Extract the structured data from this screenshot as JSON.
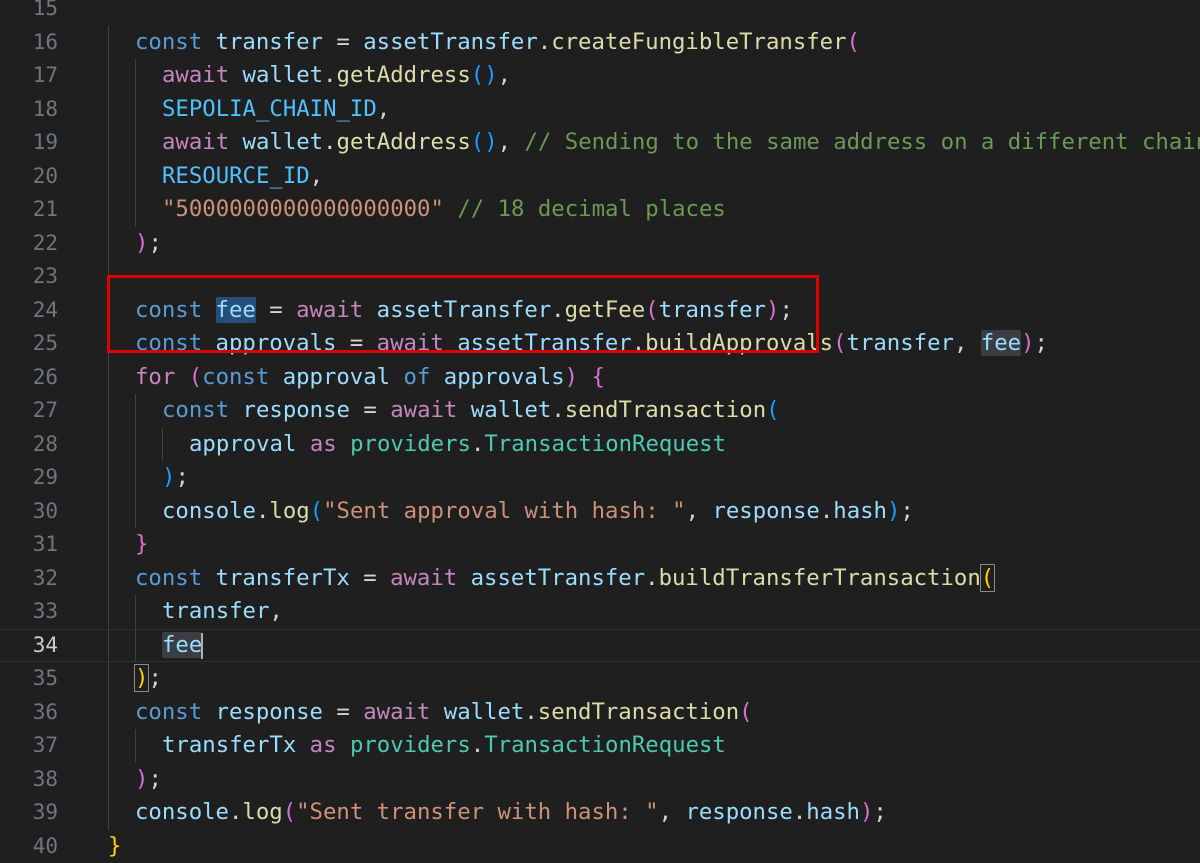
{
  "editor": {
    "active_line": 34,
    "lines": [
      {
        "n": "15",
        "parts": []
      },
      {
        "n": "16",
        "parts": [
          [
            "kw",
            "const "
          ],
          [
            "var",
            "transfer"
          ],
          [
            "pn",
            " = "
          ],
          [
            "var",
            "assetTransfer"
          ],
          [
            "pn",
            "."
          ],
          [
            "fn",
            "createFungibleTransfer"
          ],
          [
            "br1",
            "("
          ]
        ]
      },
      {
        "n": "17",
        "parts": [
          [
            "ctl",
            "await "
          ],
          [
            "var",
            "wallet"
          ],
          [
            "pn",
            "."
          ],
          [
            "fn",
            "getAddress"
          ],
          [
            "br2",
            "()"
          ],
          [
            "pn",
            ","
          ]
        ]
      },
      {
        "n": "18",
        "parts": [
          [
            "con",
            "SEPOLIA_CHAIN_ID"
          ],
          [
            "pn",
            ","
          ]
        ]
      },
      {
        "n": "19",
        "parts": [
          [
            "ctl",
            "await "
          ],
          [
            "var",
            "wallet"
          ],
          [
            "pn",
            "."
          ],
          [
            "fn",
            "getAddress"
          ],
          [
            "br2",
            "()"
          ],
          [
            "pn",
            ", "
          ],
          [
            "cmt",
            "// Sending to the same address on a different chain"
          ]
        ]
      },
      {
        "n": "20",
        "parts": [
          [
            "con",
            "RESOURCE_ID"
          ],
          [
            "pn",
            ","
          ]
        ]
      },
      {
        "n": "21",
        "parts": [
          [
            "str",
            "\"5000000000000000000\""
          ],
          [
            "pn",
            " "
          ],
          [
            "cmt",
            "// 18 decimal places"
          ]
        ]
      },
      {
        "n": "22",
        "parts": [
          [
            "br1",
            ")"
          ],
          [
            "pn",
            ";"
          ]
        ]
      },
      {
        "n": "23",
        "parts": []
      },
      {
        "n": "24",
        "parts": [
          [
            "kw",
            "const "
          ],
          [
            "var",
            "fee"
          ],
          [
            "pn",
            " = "
          ],
          [
            "ctl",
            "await "
          ],
          [
            "var",
            "assetTransfer"
          ],
          [
            "pn",
            "."
          ],
          [
            "fn",
            "getFee"
          ],
          [
            "br1",
            "("
          ],
          [
            "var",
            "transfer"
          ],
          [
            "br1",
            ")"
          ],
          [
            "pn",
            ";"
          ]
        ]
      },
      {
        "n": "25",
        "parts": [
          [
            "kw",
            "const "
          ],
          [
            "var",
            "approvals"
          ],
          [
            "pn",
            " = "
          ],
          [
            "ctl",
            "await "
          ],
          [
            "var",
            "assetTransfer"
          ],
          [
            "pn",
            "."
          ],
          [
            "fn",
            "buildApprovals"
          ],
          [
            "br1",
            "("
          ],
          [
            "var",
            "transfer"
          ],
          [
            "pn",
            ", "
          ],
          [
            "var",
            "fee"
          ],
          [
            "br1",
            ")"
          ],
          [
            "pn",
            ";"
          ]
        ]
      },
      {
        "n": "26",
        "parts": [
          [
            "ctl",
            "for "
          ],
          [
            "br1",
            "("
          ],
          [
            "kw",
            "const "
          ],
          [
            "var",
            "approval"
          ],
          [
            "kw",
            " of "
          ],
          [
            "var",
            "approvals"
          ],
          [
            "br1",
            ")"
          ],
          [
            "pn",
            " "
          ],
          [
            "br1",
            "{"
          ]
        ]
      },
      {
        "n": "27",
        "parts": [
          [
            "kw",
            "const "
          ],
          [
            "var",
            "response"
          ],
          [
            "pn",
            " = "
          ],
          [
            "ctl",
            "await "
          ],
          [
            "var",
            "wallet"
          ],
          [
            "pn",
            "."
          ],
          [
            "fn",
            "sendTransaction"
          ],
          [
            "br2",
            "("
          ]
        ]
      },
      {
        "n": "28",
        "parts": [
          [
            "var",
            "approval"
          ],
          [
            "ctl",
            " as "
          ],
          [
            "typ",
            "providers"
          ],
          [
            "pn",
            "."
          ],
          [
            "typ",
            "TransactionRequest"
          ]
        ]
      },
      {
        "n": "29",
        "parts": [
          [
            "br2",
            ")"
          ],
          [
            "pn",
            ";"
          ]
        ]
      },
      {
        "n": "30",
        "parts": [
          [
            "var",
            "console"
          ],
          [
            "pn",
            "."
          ],
          [
            "fn",
            "log"
          ],
          [
            "br2",
            "("
          ],
          [
            "str",
            "\"Sent approval with hash: \""
          ],
          [
            "pn",
            ", "
          ],
          [
            "var",
            "response"
          ],
          [
            "pn",
            "."
          ],
          [
            "var",
            "hash"
          ],
          [
            "br2",
            ")"
          ],
          [
            "pn",
            ";"
          ]
        ]
      },
      {
        "n": "31",
        "parts": [
          [
            "br1",
            "}"
          ]
        ]
      },
      {
        "n": "32",
        "parts": [
          [
            "kw",
            "const "
          ],
          [
            "var",
            "transferTx"
          ],
          [
            "pn",
            " = "
          ],
          [
            "ctl",
            "await "
          ],
          [
            "var",
            "assetTransfer"
          ],
          [
            "pn",
            "."
          ],
          [
            "fn",
            "buildTransferTransaction"
          ],
          [
            "br3",
            "("
          ]
        ]
      },
      {
        "n": "33",
        "parts": [
          [
            "var",
            "transfer"
          ],
          [
            "pn",
            ","
          ]
        ]
      },
      {
        "n": "34",
        "parts": [
          [
            "var",
            "fee"
          ]
        ]
      },
      {
        "n": "35",
        "parts": [
          [
            "br3",
            ")"
          ],
          [
            "pn",
            ";"
          ]
        ]
      },
      {
        "n": "36",
        "parts": [
          [
            "kw",
            "const "
          ],
          [
            "var",
            "response"
          ],
          [
            "pn",
            " = "
          ],
          [
            "ctl",
            "await "
          ],
          [
            "var",
            "wallet"
          ],
          [
            "pn",
            "."
          ],
          [
            "fn",
            "sendTransaction"
          ],
          [
            "br1",
            "("
          ]
        ]
      },
      {
        "n": "37",
        "parts": [
          [
            "var",
            "transferTx"
          ],
          [
            "ctl",
            " as "
          ],
          [
            "typ",
            "providers"
          ],
          [
            "pn",
            "."
          ],
          [
            "typ",
            "TransactionRequest"
          ]
        ]
      },
      {
        "n": "38",
        "parts": [
          [
            "br1",
            ")"
          ],
          [
            "pn",
            ";"
          ]
        ]
      },
      {
        "n": "39",
        "parts": [
          [
            "var",
            "console"
          ],
          [
            "pn",
            "."
          ],
          [
            "fn",
            "log"
          ],
          [
            "br1",
            "("
          ],
          [
            "str",
            "\"Sent transfer with hash: \""
          ],
          [
            "pn",
            ", "
          ],
          [
            "var",
            "response"
          ],
          [
            "pn",
            "."
          ],
          [
            "var",
            "hash"
          ],
          [
            "br1",
            ")"
          ],
          [
            "pn",
            ";"
          ]
        ]
      },
      {
        "n": "40",
        "parts": [
          [
            "br3",
            "}"
          ]
        ]
      }
    ]
  },
  "colors": {
    "background": "#1f1f1f",
    "annotation_box": "#e00000",
    "selection_highlight": "#264f78",
    "occurrence_highlight": "#3a3d41"
  }
}
